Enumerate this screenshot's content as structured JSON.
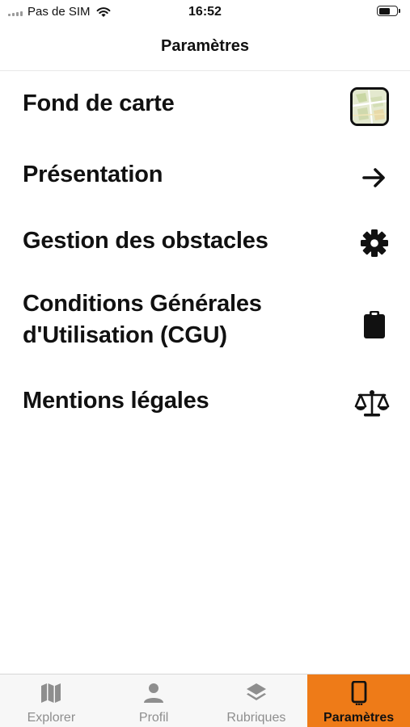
{
  "status_bar": {
    "carrier": "Pas de SIM",
    "time": "16:52"
  },
  "header": {
    "title": "Paramètres"
  },
  "settings": [
    {
      "label": "Fond de carte",
      "icon": "map-thumbnail-icon"
    },
    {
      "label": "Présentation",
      "icon": "arrow-right-icon"
    },
    {
      "label": "Gestion des obstacles",
      "icon": "gear-icon"
    },
    {
      "label_line1": "Conditions Générales",
      "label_line2": "d'Utilisation (CGU)",
      "icon": "clipboard-icon"
    },
    {
      "label": "Mentions légales",
      "icon": "scale-icon"
    }
  ],
  "tab_bar": {
    "tabs": [
      {
        "label": "Explorer",
        "icon": "map-icon"
      },
      {
        "label": "Profil",
        "icon": "person-icon"
      },
      {
        "label": "Rubriques",
        "icon": "layers-icon"
      },
      {
        "label": "Paramètres",
        "icon": "phone-icon"
      }
    ],
    "active_index": 3,
    "active_color": "#ee7b18",
    "inactive_color": "#8e8e8e"
  }
}
